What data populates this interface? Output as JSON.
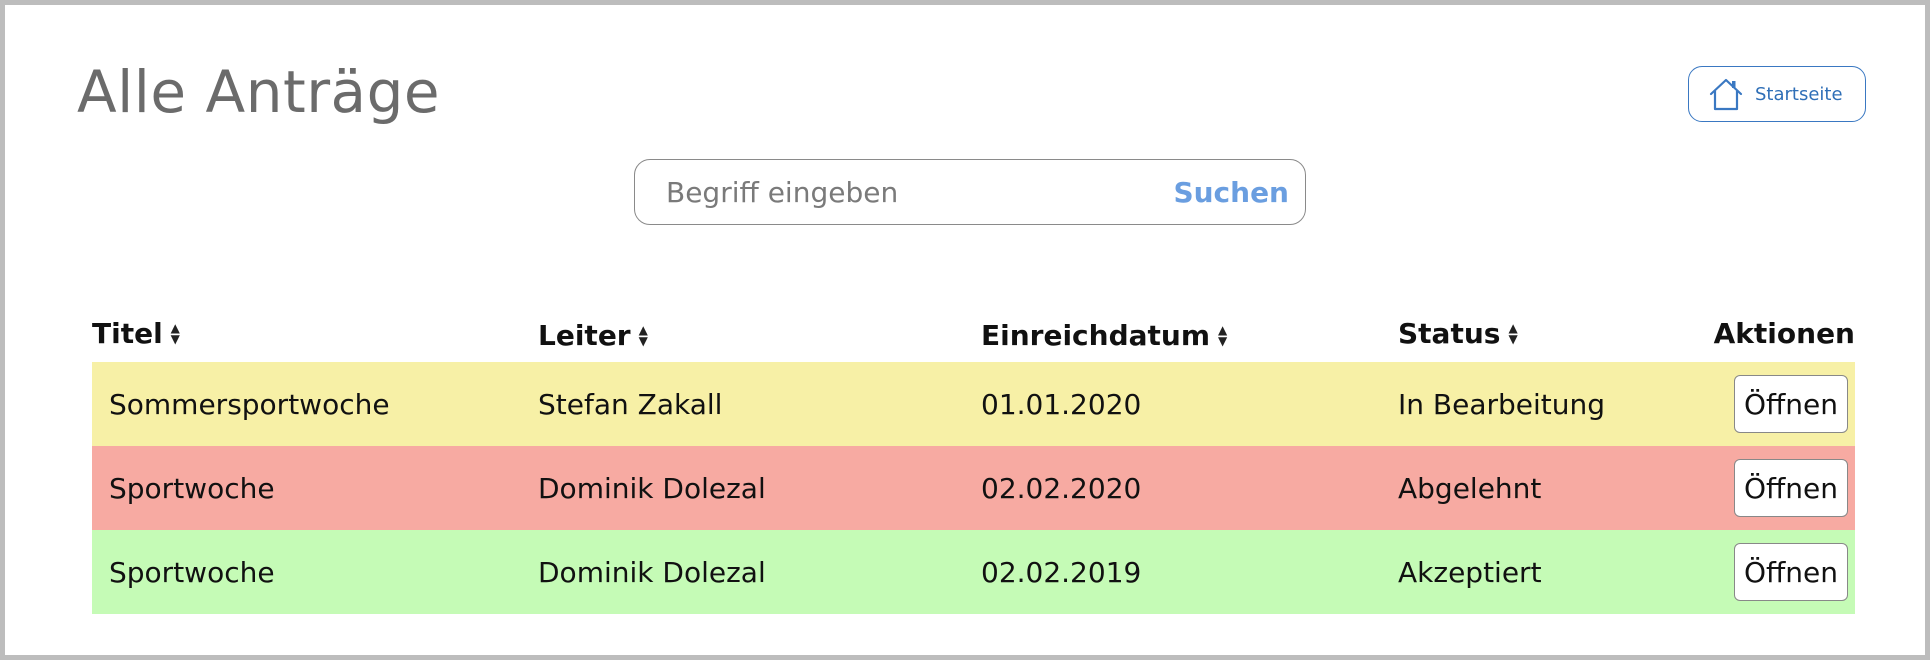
{
  "header": {
    "title": "Alle Anträge",
    "home_button_label": "Startseite",
    "home_icon": "home-icon"
  },
  "search": {
    "placeholder": "Begriff eingeben",
    "value": "",
    "button_label": "Suchen"
  },
  "table": {
    "columns": [
      "Titel",
      "Leiter",
      "Einreichdatum",
      "Status",
      "Aktionen"
    ],
    "sort_icon": "sort-icon",
    "rows": [
      {
        "titel": "Sommersportwoche",
        "leiter": "Stefan Zakall",
        "datum": "01.01.2020",
        "status": "In Bearbeitung",
        "action": "Öffnen",
        "color": "#f7f0a6"
      },
      {
        "titel": "Sportwoche",
        "leiter": "Dominik Dolezal",
        "datum": "02.02.2020",
        "status": "Abgelehnt",
        "action": "Öffnen",
        "color": "#f7aaa2"
      },
      {
        "titel": "Sportwoche",
        "leiter": "Dominik Dolezal",
        "datum": "02.02.2019",
        "status": "Akzeptiert",
        "action": "Öffnen",
        "color": "#c5fbb6"
      }
    ]
  },
  "colors": {
    "accent": "#3a78c2",
    "search_button": "#6a9ee0",
    "title": "#6b6b6b"
  }
}
